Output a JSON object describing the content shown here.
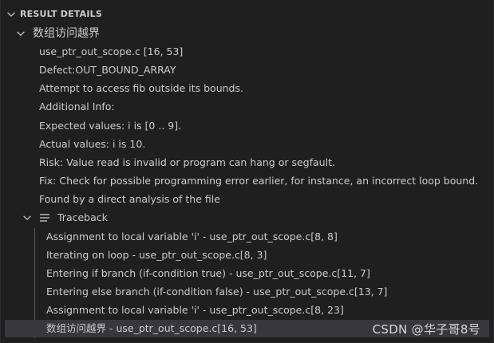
{
  "header": {
    "title": "RESULT DETAILS"
  },
  "issue": {
    "title": "数组访问越界",
    "details": [
      "use_ptr_out_scope.c [16, 53]",
      "Defect:OUT_BOUND_ARRAY",
      "Attempt to access fib outside its bounds.",
      "Additional Info:",
      "Expected values: i is [0 .. 9].",
      "Actual values: i is 10.",
      "Risk: Value read is invalid or program can hang or segfault.",
      "Fix: Check for possible programming error earlier, for instance, an incorrect loop bound.",
      "Found by a direct analysis of the file"
    ]
  },
  "traceback": {
    "label": "Traceback",
    "icon": "list-icon",
    "items": [
      "Assignment to local variable 'i' - use_ptr_out_scope.c[8, 8]",
      "Iterating on loop - use_ptr_out_scope.c[8, 3]",
      "Entering if branch (if-condition true) - use_ptr_out_scope.c[11, 7]",
      "Entering else branch (if-condition false) - use_ptr_out_scope.c[13, 7]",
      "Assignment to local variable 'i' - use_ptr_out_scope.c[8, 23]",
      "数组访问越界 - use_ptr_out_scope.c[16, 53]"
    ],
    "selected_index": 5
  },
  "watermark": "CSDN @华子哥8号",
  "colors": {
    "background": "#1f1f1f",
    "text": "#cccccc",
    "selected_row": "#37373d",
    "indent_guide": "#585858"
  }
}
